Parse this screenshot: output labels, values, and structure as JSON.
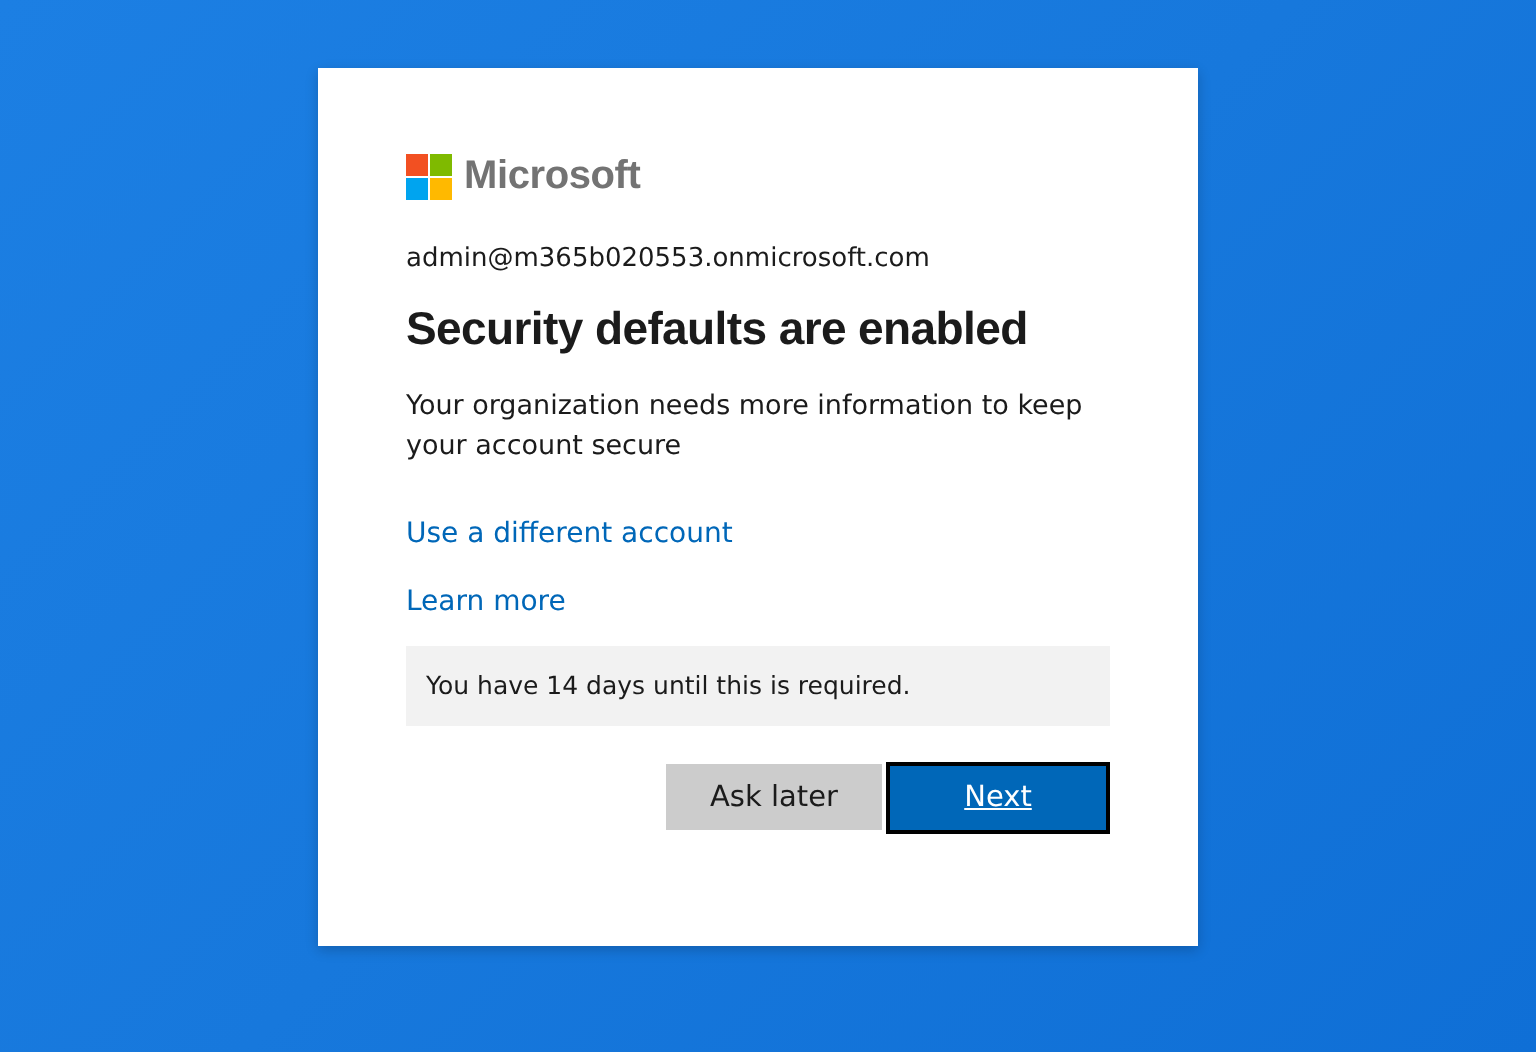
{
  "logo": {
    "text": "Microsoft"
  },
  "account": "admin@m365b020553.onmicrosoft.com",
  "title": "Security defaults are enabled",
  "description": "Your organization needs more information to keep your account secure",
  "links": [
    "Use a different account",
    "Learn more"
  ],
  "notice": "You have 14 days until this is required.",
  "buttons": [
    {
      "label": "Ask later",
      "kind": "secondary",
      "focused": false
    },
    {
      "label": "Next",
      "kind": "primary",
      "focused": true
    }
  ]
}
